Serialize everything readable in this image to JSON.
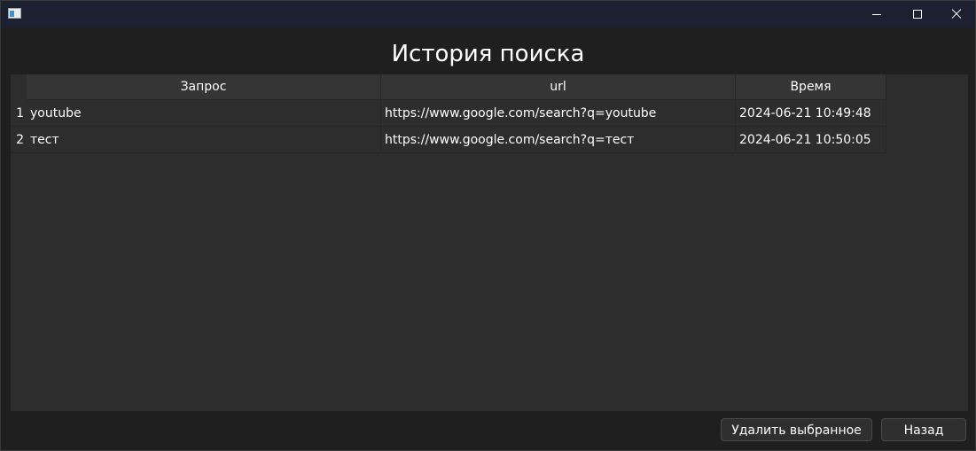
{
  "window": {
    "icon": "app-window-icon",
    "controls": {
      "minimize": "minimize-icon",
      "maximize": "maximize-icon",
      "close": "close-icon"
    }
  },
  "page": {
    "title": "История поиска"
  },
  "table": {
    "columns": [
      "Запрос",
      "url",
      "Время"
    ],
    "rows": [
      {
        "index": "1",
        "query": "youtube",
        "url": "https://www.google.com/search?q=youtube",
        "time": "2024-06-21 10:49:48"
      },
      {
        "index": "2",
        "query": "тест",
        "url": "https://www.google.com/search?q=тест",
        "time": "2024-06-21 10:50:05"
      }
    ]
  },
  "actions": {
    "delete_label": "Удалить выбранное",
    "back_label": "Назад"
  },
  "colors": {
    "titlebar": "#1c2030",
    "window_bg": "#1f1f1f",
    "table_bg": "#2d2d2d",
    "header_bg": "#353535",
    "text": "#ffffff"
  }
}
